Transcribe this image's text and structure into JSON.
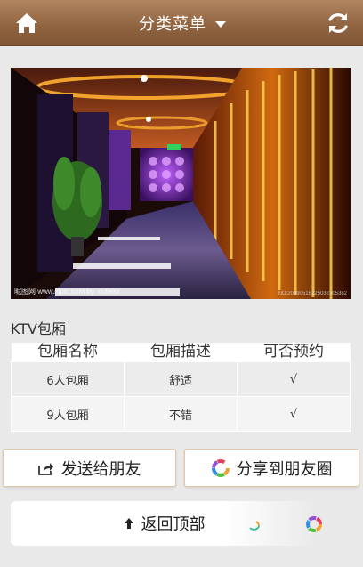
{
  "header": {
    "title": "分类菜单",
    "home_icon": "home-icon",
    "refresh_icon": "refresh-icon",
    "colors": {
      "bar": "#8f6340"
    }
  },
  "photo": {
    "alt": "KTV corridor photo",
    "watermark_left": "昵图网 www.nipic.com  by: cutelsx",
    "watermark_right": "NO:20090516225032305382"
  },
  "section": {
    "title": "KTV包厢"
  },
  "table": {
    "headers": [
      "包厢名称",
      "包厢描述",
      "可否预约"
    ],
    "rows": [
      [
        "6人包厢",
        "舒适",
        "√"
      ],
      [
        "9人包厢",
        "不错",
        "√"
      ]
    ]
  },
  "actions": {
    "send_label": "发送给朋友",
    "share_label": "分享到朋友圈",
    "back_top_label": "返回顶部"
  }
}
